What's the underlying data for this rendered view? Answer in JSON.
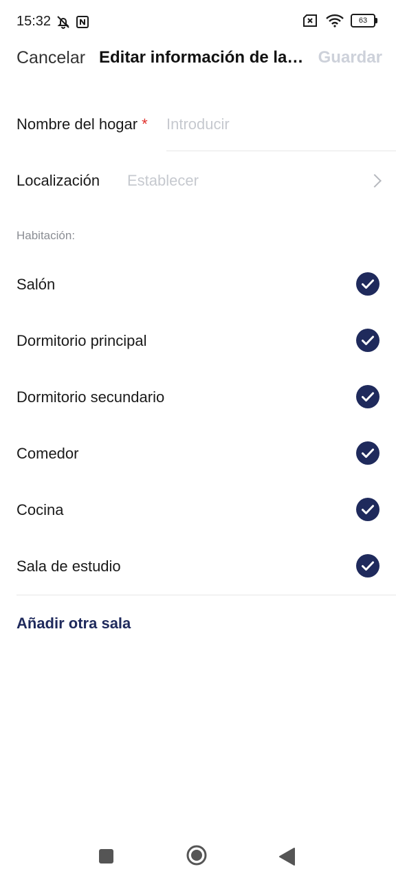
{
  "status_bar": {
    "time": "15:32",
    "battery": "63"
  },
  "header": {
    "cancel_label": "Cancelar",
    "title": "Editar información de la…",
    "save_label": "Guardar"
  },
  "form": {
    "home_name": {
      "label": "Nombre del hogar",
      "required_mark": "*",
      "placeholder": "Introducir",
      "value": ""
    },
    "location": {
      "label": "Localización",
      "value_placeholder": "Establecer"
    }
  },
  "rooms_section": {
    "label": "Habitación:",
    "rooms": [
      {
        "name": "Salón",
        "checked": true
      },
      {
        "name": "Dormitorio principal",
        "checked": true
      },
      {
        "name": "Dormitorio secundario",
        "checked": true
      },
      {
        "name": "Comedor",
        "checked": true
      },
      {
        "name": "Cocina",
        "checked": true
      },
      {
        "name": "Sala de estudio",
        "checked": true
      }
    ],
    "add_room_label": "Añadir otra sala"
  },
  "colors": {
    "accent": "#1f2a5c",
    "required": "#e0302c",
    "placeholder": "#c6c9cf",
    "save_disabled": "#cdd1da"
  },
  "icons": {
    "status_left": [
      "bell-off-icon",
      "nfc-icon"
    ],
    "status_right": [
      "sim-off-icon",
      "wifi-icon",
      "battery-icon"
    ],
    "room_check": "check-circle-icon",
    "location_chevron": "chevron-right-icon",
    "nav": [
      "recent-apps-icon",
      "home-icon",
      "back-icon"
    ]
  }
}
